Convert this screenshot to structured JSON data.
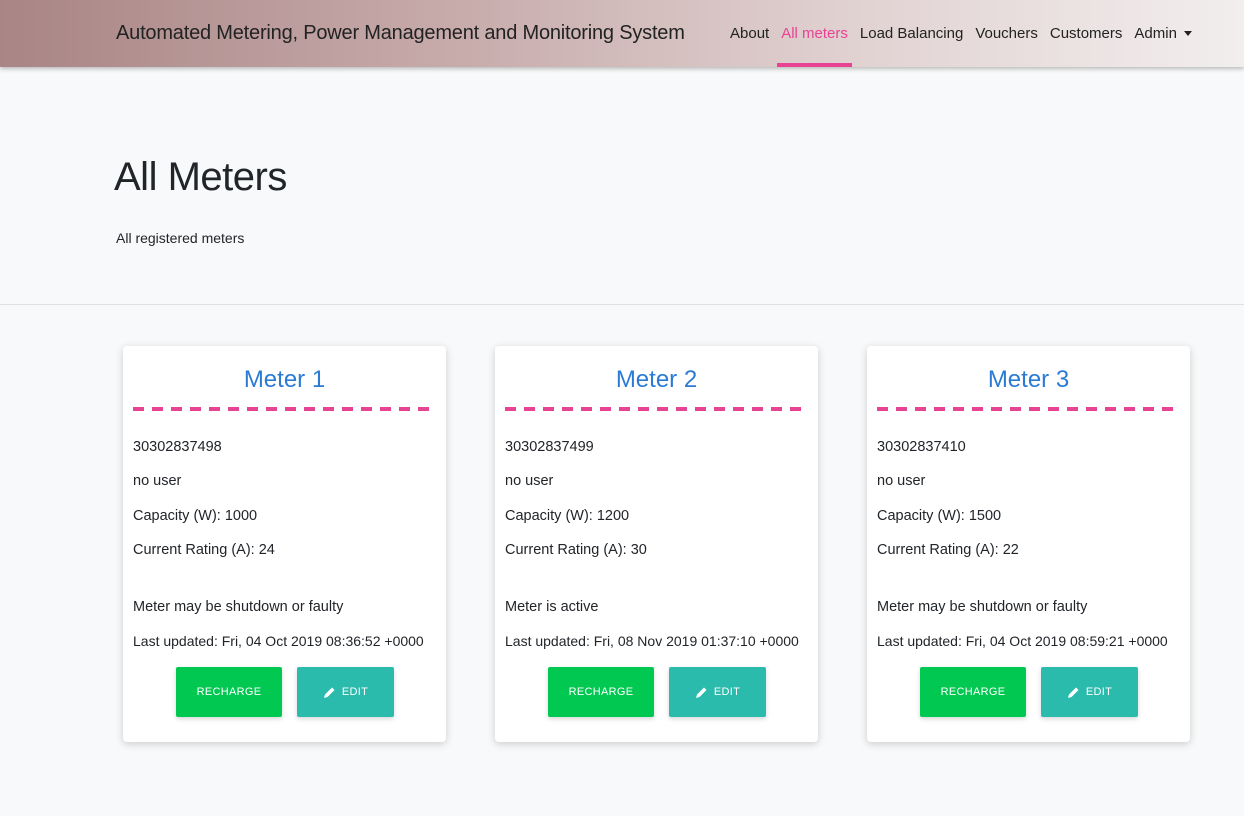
{
  "navbar": {
    "brand": "Automated Metering, Power Management and Monitoring System",
    "links": [
      {
        "label": "About"
      },
      {
        "label": "All meters"
      },
      {
        "label": "Load Balancing"
      },
      {
        "label": "Vouchers"
      },
      {
        "label": "Customers"
      },
      {
        "label": "Admin"
      }
    ],
    "active_link": "All meters",
    "dropdown_icon": "caret-down-icon"
  },
  "header": {
    "title": "All Meters",
    "subtitle": "All registered meters"
  },
  "meters": [
    {
      "title": "Meter 1",
      "serial": "30302837498",
      "user": "no user",
      "capacity": "Capacity (W): 1000",
      "current_rating": "Current Rating (A): 24",
      "status": "Meter may be shutdown or faulty",
      "last_updated": "Last updated: Fri, 04 Oct 2019 08:36:52 +0000",
      "recharge_label": "RECHARGE",
      "edit_label": "EDIT"
    },
    {
      "title": "Meter 2",
      "serial": "30302837499",
      "user": "no user",
      "capacity": "Capacity (W): 1200",
      "current_rating": "Current Rating (A): 30",
      "status": "Meter is active",
      "last_updated": "Last updated: Fri, 08 Nov 2019 01:37:10 +0000",
      "recharge_label": "RECHARGE",
      "edit_label": "EDIT"
    },
    {
      "title": "Meter 3",
      "serial": "30302837410",
      "user": "no user",
      "capacity": "Capacity (W): 1500",
      "current_rating": "Current Rating (A): 22",
      "status": "Meter may be shutdown or faulty",
      "last_updated": "Last updated: Fri, 04 Oct 2019 08:59:21 +0000",
      "recharge_label": "RECHARGE",
      "edit_label": "EDIT"
    }
  ],
  "colors": {
    "accent": "#e84393",
    "card_title": "#2b7bd4",
    "recharge_button": "#00c851",
    "edit_button": "#2bbbad"
  }
}
